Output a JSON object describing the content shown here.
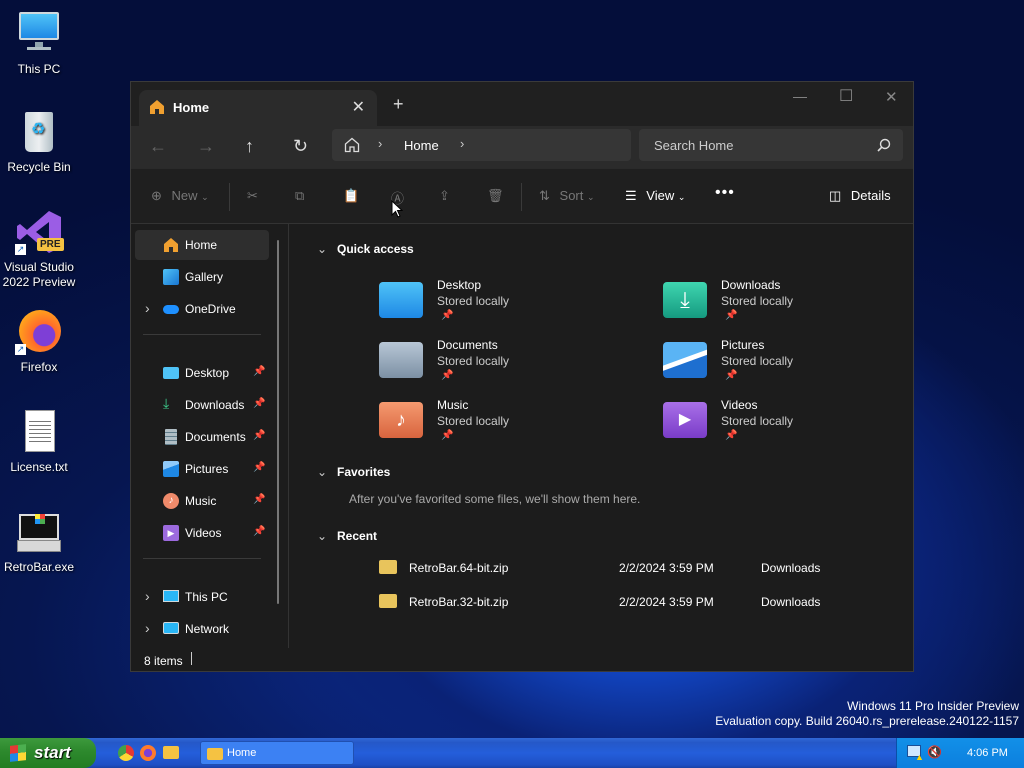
{
  "desktop": {
    "icons": [
      {
        "label": "This PC",
        "icon": "this-pc-icon"
      },
      {
        "label": "Recycle Bin",
        "icon": "recycle-bin-icon"
      },
      {
        "label": "Visual Studio 2022 Preview",
        "icon": "visual-studio-icon",
        "badge": "PRE"
      },
      {
        "label": "Firefox",
        "icon": "firefox-icon"
      },
      {
        "label": "License.txt",
        "icon": "text-file-icon"
      },
      {
        "label": "RetroBar.exe",
        "icon": "retrobar-icon"
      }
    ],
    "watermark_line1": "Windows 11 Pro Insider Preview",
    "watermark_line2": "Evaluation copy. Build 26040.rs_prerelease.240122-1157"
  },
  "explorer": {
    "tab_title": "Home",
    "breadcrumb": [
      "Home"
    ],
    "search_placeholder": "Search Home",
    "toolbar": {
      "new_label": "New",
      "sort_label": "Sort",
      "view_label": "View",
      "details_label": "Details"
    },
    "sidebar": {
      "top": [
        {
          "label": "Home",
          "icon": "home-icon",
          "selected": true
        },
        {
          "label": "Gallery",
          "icon": "gallery-icon"
        },
        {
          "label": "OneDrive",
          "icon": "onedrive-icon"
        }
      ],
      "pinned": [
        {
          "label": "Desktop",
          "icon": "desktop-folder-icon",
          "color": "#4fc3f7"
        },
        {
          "label": "Downloads",
          "icon": "download-icon",
          "color": "#3ecf8e"
        },
        {
          "label": "Documents",
          "icon": "documents-icon",
          "color": "#b0bec5"
        },
        {
          "label": "Pictures",
          "icon": "pictures-icon",
          "color": "#42a5f5"
        },
        {
          "label": "Music",
          "icon": "music-icon",
          "color": "#ef8a6a"
        },
        {
          "label": "Videos",
          "icon": "videos-icon",
          "color": "#9c6ade"
        }
      ],
      "bottom": [
        {
          "label": "This PC",
          "icon": "this-pc-icon"
        },
        {
          "label": "Network",
          "icon": "network-icon"
        }
      ]
    },
    "sections": {
      "quick_access": "Quick access",
      "favorites": "Favorites",
      "favorites_empty": "After you've favorited some files, we'll show them here.",
      "recent": "Recent"
    },
    "quick_access_items": [
      {
        "name": "Desktop",
        "sub": "Stored locally",
        "color": "#3aa5e8"
      },
      {
        "name": "Downloads",
        "sub": "Stored locally",
        "color": "#20a38a"
      },
      {
        "name": "Documents",
        "sub": "Stored locally",
        "color": "#8fa4b8"
      },
      {
        "name": "Pictures",
        "sub": "Stored locally",
        "color": "#2d8fe0"
      },
      {
        "name": "Music",
        "sub": "Stored locally",
        "color": "#e87a55"
      },
      {
        "name": "Videos",
        "sub": "Stored locally",
        "color": "#8a4fd0"
      }
    ],
    "recent_files": [
      {
        "name": "RetroBar.64-bit.zip",
        "date": "2/2/2024 3:59 PM",
        "location": "Downloads"
      },
      {
        "name": "RetroBar.32-bit.zip",
        "date": "2/2/2024 3:59 PM",
        "location": "Downloads"
      }
    ],
    "status_text": "8 items"
  },
  "taskbar": {
    "start_label": "start",
    "window_button": "Home",
    "clock": "4:06 PM"
  }
}
